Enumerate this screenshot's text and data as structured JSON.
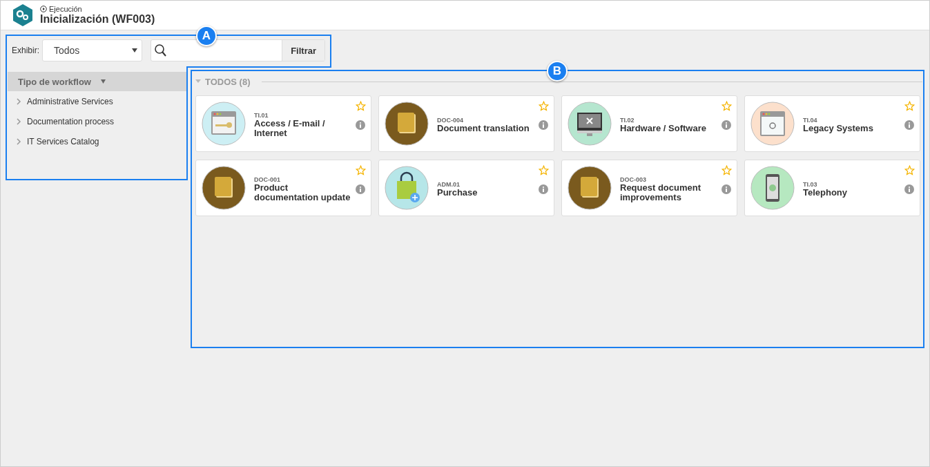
{
  "header": {
    "breadcrumb": "Ejecución",
    "title": "Inicialización (WF003)"
  },
  "filter": {
    "label": "Exhibir:",
    "select_value": "Todos",
    "button": "Filtrar"
  },
  "sidebar": {
    "title": "Tipo de workflow",
    "items": [
      {
        "label": "Administrative Services",
        "expanded": false
      },
      {
        "label": "Documentation process",
        "expanded": false
      },
      {
        "label": "IT Services Catalog",
        "expanded": false
      }
    ]
  },
  "group": {
    "title": "TODOS (8)",
    "expanded": true
  },
  "cards": [
    {
      "code": "TI.01",
      "name": "Access / E-mail / Internet",
      "kind": "window-key",
      "favorite": false
    },
    {
      "code": "DOC-004",
      "name": "Document translation",
      "kind": "book",
      "favorite": false
    },
    {
      "code": "TI.02",
      "name": "Hardware / Software",
      "kind": "monitor",
      "favorite": false
    },
    {
      "code": "TI.04",
      "name": "Legacy Systems",
      "kind": "window-refresh",
      "favorite": false
    },
    {
      "code": "DOC-001",
      "name": "Product documentation update",
      "kind": "book",
      "favorite": false
    },
    {
      "code": "ADM.01",
      "name": "Purchase",
      "kind": "bag",
      "favorite": false
    },
    {
      "code": "DOC-003",
      "name": "Request document improvements",
      "kind": "book",
      "favorite": false
    },
    {
      "code": "TI.03",
      "name": "Telephony",
      "kind": "phone",
      "favorite": false
    }
  ],
  "callouts": [
    {
      "label": "A"
    },
    {
      "label": "B"
    }
  ]
}
